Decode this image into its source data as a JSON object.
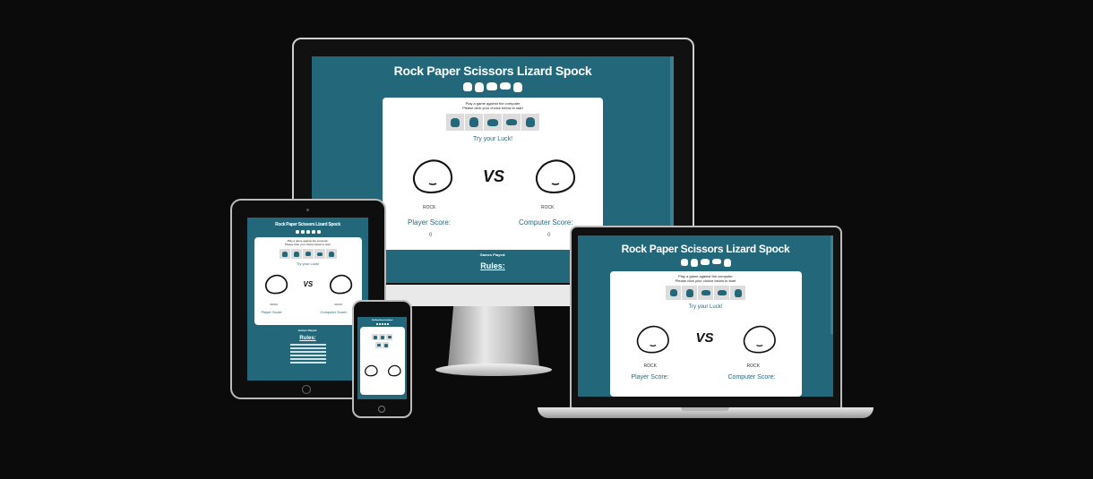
{
  "game": {
    "title": "Rock Paper Scissors Lizard Spock",
    "intro1": "Play a game against the computer",
    "intro2": "Please click your choice below to start",
    "try": "Try your Luck!",
    "vs": "VS",
    "player_choice": "ROCK",
    "computer_choice": "ROCK",
    "player_score_label": "Player Score:",
    "computer_score_label": "Computer Score:",
    "player_score": "0",
    "computer_score": "0",
    "games_played": "Games Played:",
    "rules_heading": "Rules:",
    "choices": [
      "Rock",
      "Paper",
      "Scissors",
      "Lizard",
      "Spock"
    ]
  },
  "icons": {
    "title_hands": [
      "rock-hand-icon",
      "paper-hand-icon",
      "scissors-hand-icon",
      "lizard-hand-icon",
      "spock-hand-icon"
    ],
    "choice_buttons": [
      "rock-button-icon",
      "paper-button-icon",
      "scissors-button-icon",
      "lizard-button-icon",
      "spock-button-icon"
    ]
  },
  "colors": {
    "background": "#0b0b0b",
    "brand_teal": "#23687a",
    "card": "#ffffff",
    "button_gray": "#dcdcdc"
  }
}
